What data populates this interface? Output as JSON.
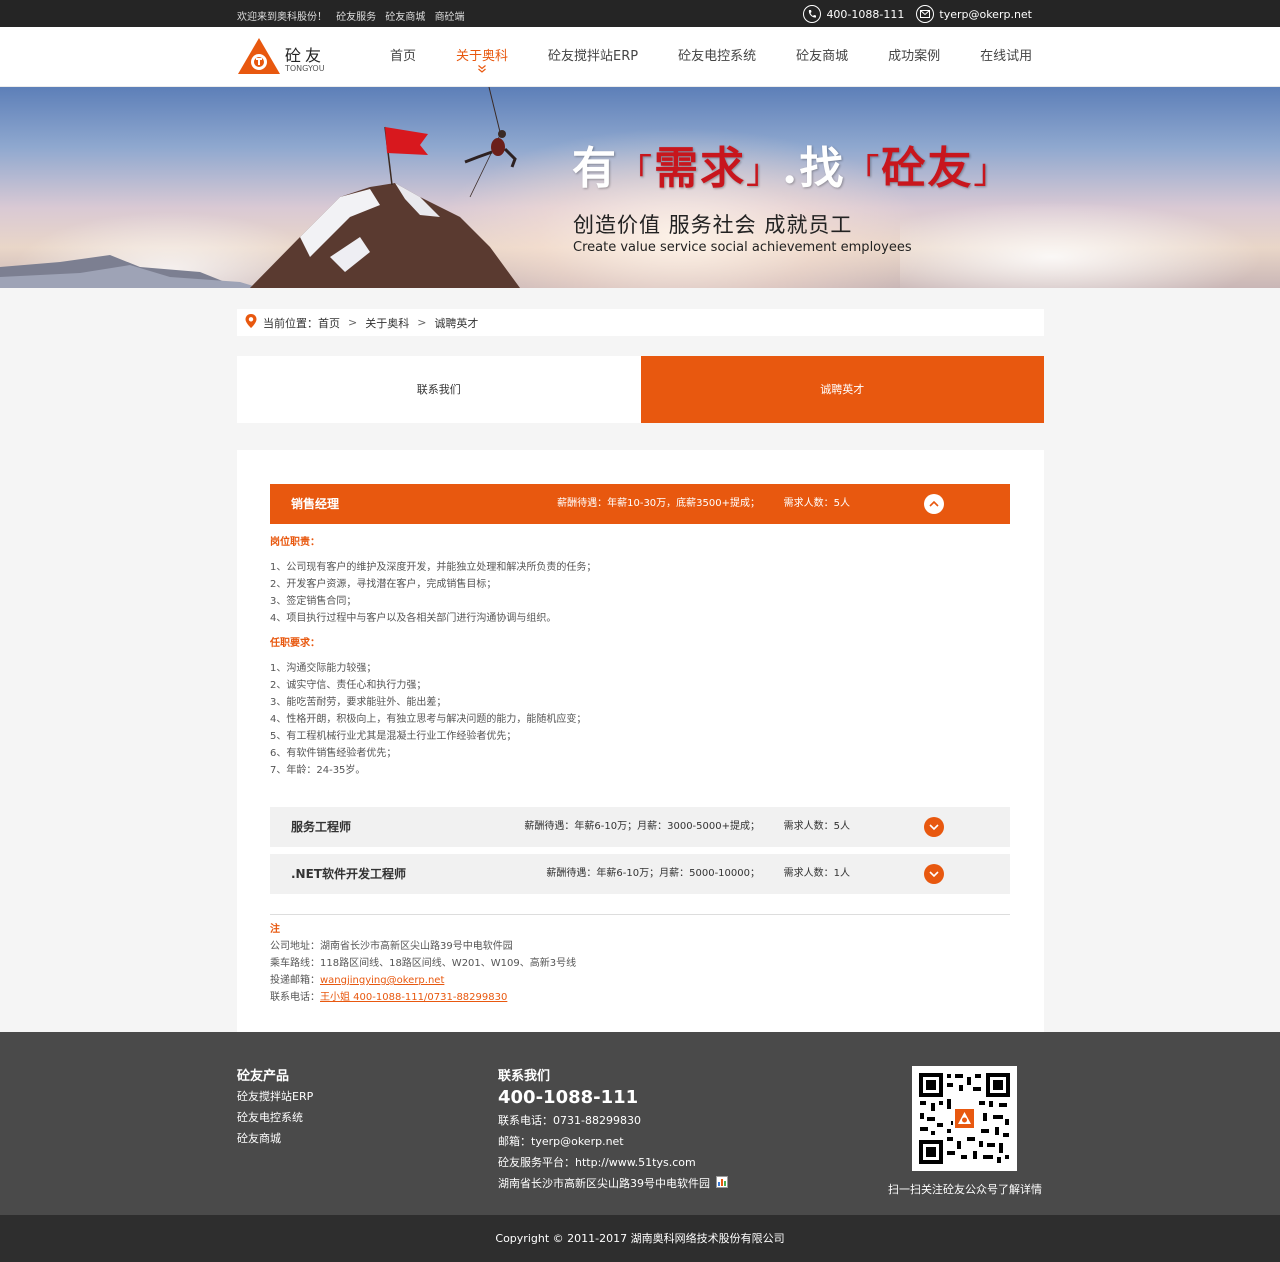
{
  "topbar": {
    "welcome": "欢迎来到奥科股份！",
    "links": [
      "砼友服务",
      "砼友商城",
      "商砼端"
    ],
    "phone": "400-1088-111",
    "email": "tyerp@okerp.net",
    "phone_icon": "phone-icon",
    "email_icon": "mail-icon"
  },
  "logo": {
    "cn": "砼友",
    "en": "TONGYOU"
  },
  "nav": {
    "items": [
      "首页",
      "关于奥科",
      "砼友搅拌站ERP",
      "砼友电控系统",
      "砼友商城",
      "成功案例",
      "在线试用"
    ],
    "active_index": 1
  },
  "banner": {
    "slogan_1": "有",
    "slogan_2": "需求",
    "slogan_3": ".找",
    "slogan_4": "砼友",
    "sub_cn": "创造价值  服务社会  成就员工",
    "sub_en": "Create value service social achievement employees"
  },
  "breadcrumb": {
    "label": "当前位置：",
    "items": [
      "首页",
      "关于奥科",
      "诚聘英才"
    ],
    "sep": ">"
  },
  "tabs": {
    "items": [
      "联系我们",
      "诚聘英才"
    ],
    "active_index": 1
  },
  "jobs": [
    {
      "title": "销售经理",
      "salary": "薪酬待遇：年薪10-30万，底薪3500+提成；",
      "count": "需求人数：5人",
      "expanded": true,
      "duty_title": "岗位职责：",
      "duties": [
        "1、公司现有客户的维护及深度开发，并能独立处理和解决所负责的任务；",
        "2、开发客户资源，寻找潜在客户，完成销售目标；",
        "3、签定销售合同；",
        "4、项目执行过程中与客户以及各相关部门进行沟通协调与组织。"
      ],
      "req_title": "任职要求：",
      "requirements": [
        "1、沟通交际能力较强；",
        "2、诚实守信、责任心和执行力强；",
        "3、能吃苦耐劳，要求能驻外、能出差；",
        "4、性格开朗，积极向上，有独立思考与解决问题的能力，能随机应变；",
        "5、有工程机械行业尤其是混凝土行业工作经验者优先；",
        "6、有软件销售经验者优先；",
        "7、年龄：24-35岁。"
      ]
    },
    {
      "title": "服务工程师",
      "salary": "薪酬待遇：年薪6-10万；月薪：3000-5000+提成；",
      "count": "需求人数：5人",
      "expanded": false
    },
    {
      "title": ".NET软件开发工程师",
      "salary": "薪酬待遇：年薪6-10万；月薪：5000-10000；",
      "count": "需求人数：1人",
      "expanded": false
    }
  ],
  "notes": {
    "head": "注",
    "address": "公司地址：湖南省长沙市高新区尖山路39号中电软件园",
    "bus": "乘车路线：118路区间线、18路区间线、W201、W109、高新3号线",
    "email_label": "投递邮箱：",
    "email": "wangjingying@okerp.net",
    "phone_label": "联系电话：",
    "phone": "王小姐 400-1088-111/0731-88299830"
  },
  "footer": {
    "products_title": "砼友产品",
    "products": [
      "砼友搅拌站ERP",
      "砼友电控系统",
      "砼友商城"
    ],
    "contact_title": "联系我们",
    "hotline": "400-1088-111",
    "tel": "联系电话：0731-88299830",
    "email": "邮箱：tyerp@okerp.net",
    "platform": "砼友服务平台：http://www.51tys.com",
    "address": "湖南省长沙市高新区尖山路39号中电软件园",
    "qr_caption": "扫一扫关注砼友公众号了解详情"
  },
  "copyright": "Copyright © 2011-2017 湖南奥科网络技术股份有限公司",
  "colors": {
    "accent": "#e8580f",
    "topbar": "#252525",
    "footer": "#4a4a4a",
    "copyright_bg": "#2e2e2e"
  }
}
